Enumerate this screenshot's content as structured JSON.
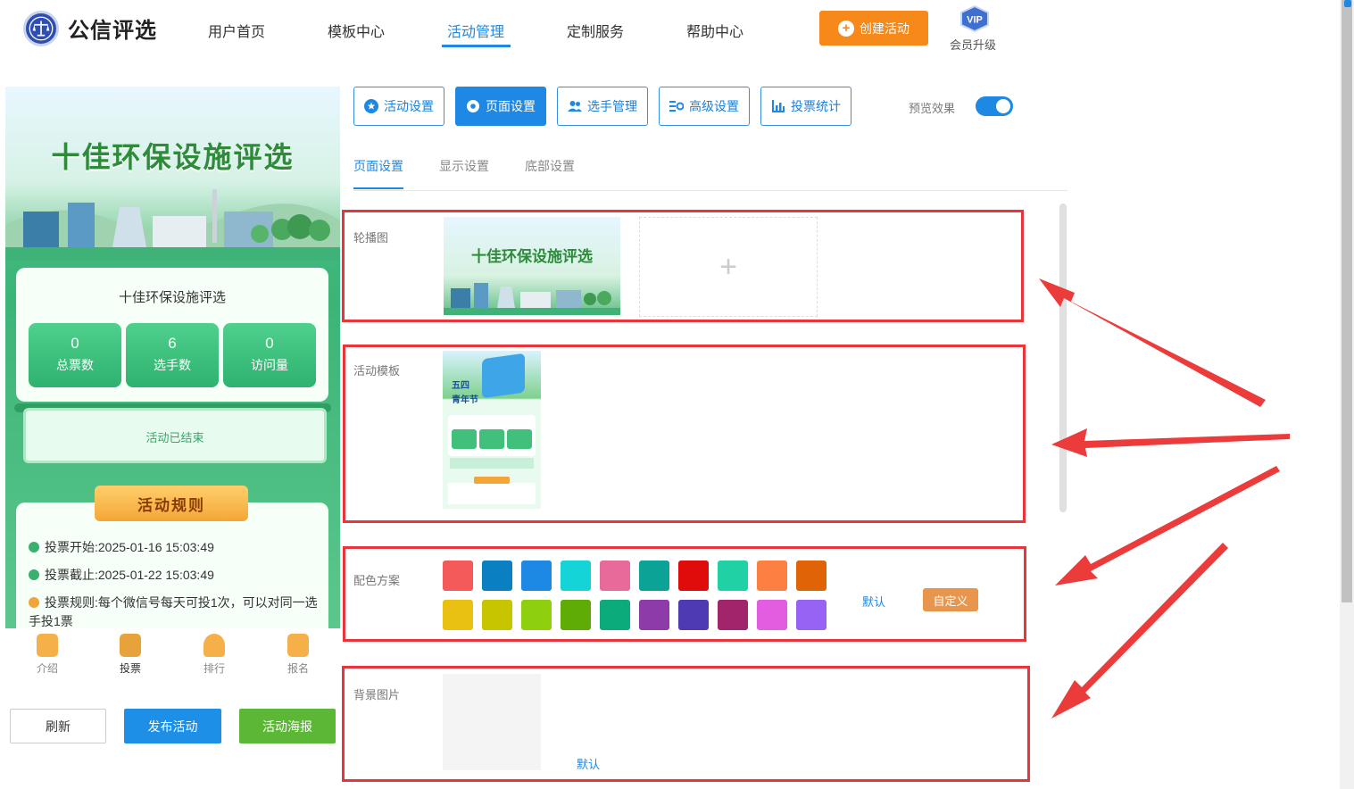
{
  "header": {
    "logo_text": "公信评选",
    "nav": [
      "用户首页",
      "模板中心",
      "活动管理",
      "定制服务",
      "帮助中心"
    ],
    "active_nav": "活动管理",
    "create_label": "创建活动",
    "vip_badge": "VIP",
    "vip_label": "会员升级"
  },
  "preview": {
    "banner_title": "十佳环保设施评选",
    "card_title": "十佳环保设施评选",
    "stats": [
      {
        "value": "0",
        "label": "总票数"
      },
      {
        "value": "6",
        "label": "选手数"
      },
      {
        "value": "0",
        "label": "访问量"
      }
    ],
    "status": "活动已结束",
    "rules_title": "活动规则",
    "rules": [
      {
        "label": "投票开始:",
        "value": "2025-01-16 15:03:49"
      },
      {
        "label": "投票截止:",
        "value": "2025-01-22 15:03:49"
      },
      {
        "label": "投票规则:",
        "value": "每个微信号每天可投1次，可以对同一选手投1票"
      }
    ],
    "tabs": [
      "介绍",
      "投票",
      "排行",
      "报名"
    ],
    "active_tab": "投票"
  },
  "actions": {
    "refresh": "刷新",
    "publish": "发布活动",
    "poster": "活动海报"
  },
  "toolbar": {
    "buttons": [
      "活动设置",
      "页面设置",
      "选手管理",
      "高级设置",
      "投票统计"
    ],
    "active": "页面设置",
    "preview_label": "预览效果",
    "preview_on": true
  },
  "subtabs": [
    "页面设置",
    "显示设置",
    "底部设置"
  ],
  "active_subtab": "页面设置",
  "sections": {
    "carousel_label": "轮播图",
    "carousel_thumb_title": "十佳环保设施评选",
    "add_symbol": "+",
    "template_label": "活动模板",
    "template_thumb": {
      "title_line1": "五四",
      "title_line2": "青年节"
    },
    "color_label": "配色方案",
    "colors_row1": [
      "#f55a5a",
      "#0a7fc2",
      "#1e88e5",
      "#14d4d8",
      "#e86a9a",
      "#0aa396",
      "#e00b0b",
      "#1fd1a5",
      "#fd7f42",
      "#e06405"
    ],
    "colors_row2": [
      "#e9c113",
      "#c6c500",
      "#8fd00e",
      "#60ac06",
      "#0cab7b",
      "#8c3ba8",
      "#4e3bb3",
      "#a2246b",
      "#e25de0",
      "#9763f4"
    ],
    "color_default": "默认",
    "color_custom": "自定义",
    "bg_label": "背景图片",
    "bg_default": "默认"
  }
}
